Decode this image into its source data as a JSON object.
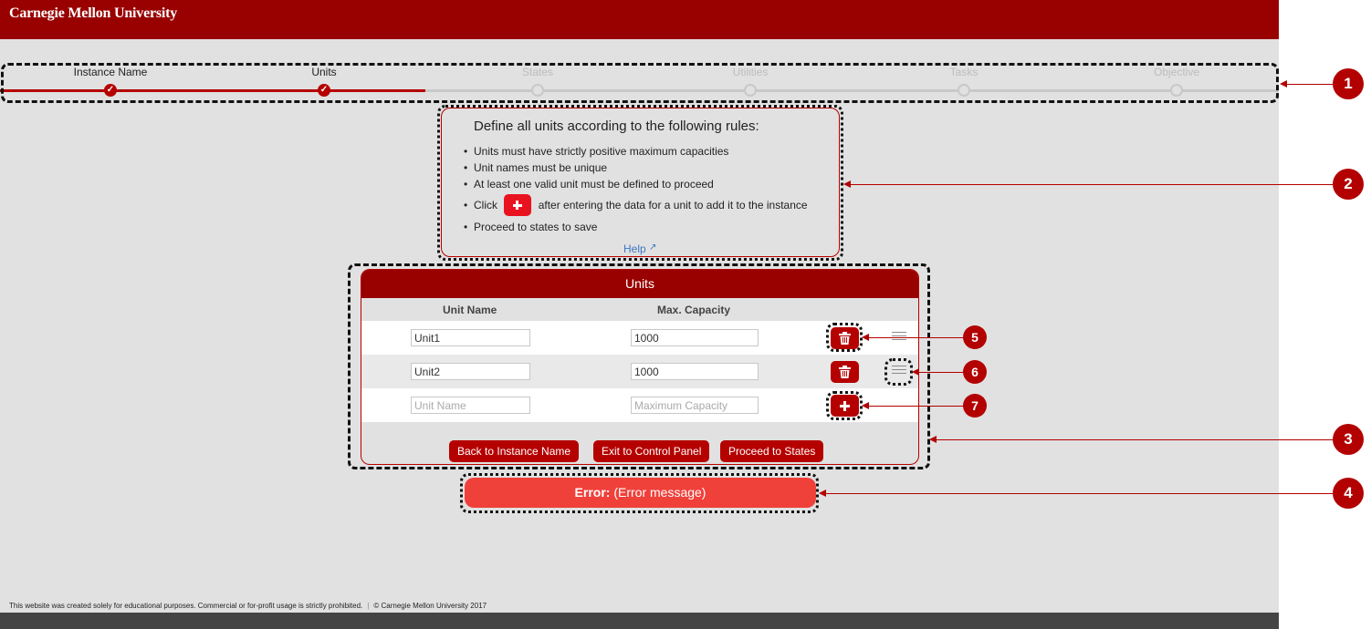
{
  "header": {
    "brand": "Carnegie Mellon University"
  },
  "stepper": {
    "steps": [
      {
        "label": "Instance Name",
        "status": "done"
      },
      {
        "label": "Units",
        "status": "done"
      },
      {
        "label": "States",
        "status": "todo"
      },
      {
        "label": "Utilities",
        "status": "todo"
      },
      {
        "label": "Tasks",
        "status": "todo"
      },
      {
        "label": "Objective",
        "status": "todo"
      }
    ]
  },
  "rules": {
    "title": "Define all units according to the following rules:",
    "items": [
      "Units must have strictly positive maximum capacities",
      "Unit names must be unique",
      "At least one valid unit must be defined to proceed"
    ],
    "click_prefix": "Click",
    "click_suffix": "after entering the data for a unit to add it to the instance",
    "last_item": "Proceed to states to save",
    "help": "Help"
  },
  "units": {
    "title": "Units",
    "col_name": "Unit Name",
    "col_capacity": "Max. Capacity",
    "rows": [
      {
        "name": "Unit1",
        "capacity": "1000"
      },
      {
        "name": "Unit2",
        "capacity": "1000"
      }
    ],
    "new_row": {
      "name_placeholder": "Unit Name",
      "capacity_placeholder": "Maximum Capacity"
    },
    "buttons": {
      "back": "Back to Instance Name",
      "exit": "Exit to Control Panel",
      "proceed": "Proceed to States"
    }
  },
  "error": {
    "label": "Error:",
    "message": "(Error message)"
  },
  "footer": {
    "notice": "This website was created solely for educational purposes. Commercial or for-profit usage is strictly prohibited.",
    "copyright": "© Carnegie Mellon University 2017"
  },
  "annotations": [
    "1",
    "2",
    "3",
    "4",
    "5",
    "6",
    "7"
  ],
  "colors": {
    "brand": "#990000",
    "accent": "#b50000",
    "error": "#f0403a",
    "annotation": "#b30000"
  }
}
